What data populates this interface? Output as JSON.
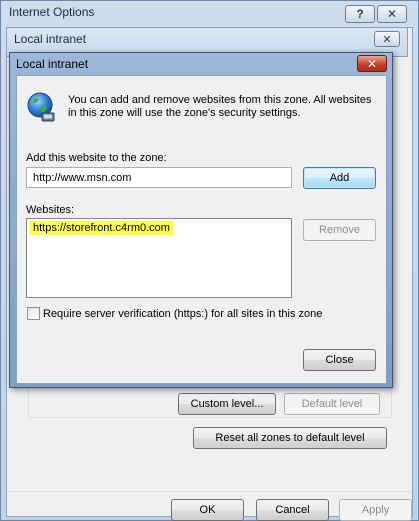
{
  "internet_options": {
    "title": "Internet Options",
    "help_glyph": "?",
    "close_glyph": "✕",
    "custom_level_label": "Custom level...",
    "default_level_label": "Default level",
    "reset_zones_label": "Reset all zones to default level",
    "ok_label": "OK",
    "cancel_label": "Cancel",
    "apply_label": "Apply"
  },
  "local_intranet_back": {
    "title": "Local intranet",
    "close_glyph": "✕"
  },
  "dialog": {
    "title": "Local intranet",
    "close_glyph": "✕",
    "icon": "globe-network-icon",
    "info_text": "You can add and remove websites from this zone. All websites in this zone will use the zone's security settings.",
    "add_label": "Add this website to the zone:",
    "url_value": "http://www.msn.com",
    "add_button": "Add",
    "websites_label": "Websites:",
    "websites": [
      "https://storefront.c4rm0.com"
    ],
    "remove_button": "Remove",
    "require_https_label": "Require server verification (https:) for all sites in this zone",
    "require_https_checked": false,
    "close_button": "Close"
  },
  "colors": {
    "highlight": "#ffff47",
    "close_red": "#c7402b",
    "title_blue": "#8eaad0"
  }
}
